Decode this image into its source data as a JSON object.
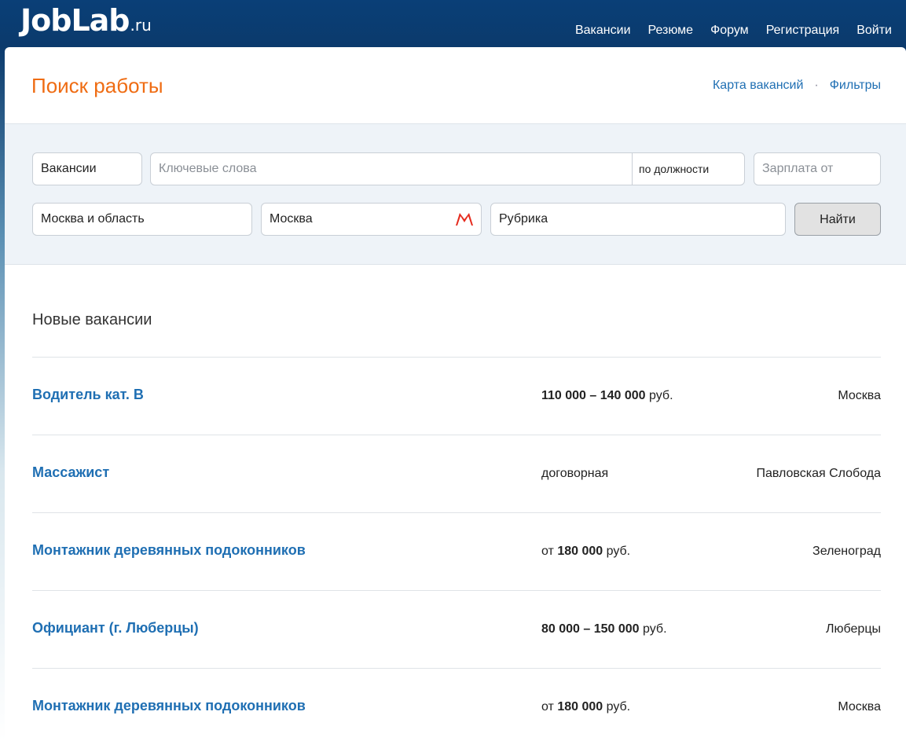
{
  "header": {
    "logo_main": "JobLab",
    "logo_tld": ".ru",
    "nav": [
      "Вакансии",
      "Резюме",
      "Форум",
      "Регистрация",
      "Войти"
    ]
  },
  "page": {
    "title": "Поиск работы",
    "links": [
      "Карта вакансий",
      "Фильтры"
    ],
    "link_separator": "·"
  },
  "search": {
    "type_value": "Вакансии",
    "keywords_placeholder": "Ключевые слова",
    "keywords_mode": "по должности",
    "salary_placeholder": "Зарплата от",
    "region_value": "Москва и область",
    "city_value": "Москва",
    "rubric_value": "Рубрика",
    "submit_label": "Найти",
    "metro_icon": "metro-icon",
    "metro_color": "#e52b1e"
  },
  "jobs_section": {
    "title": "Новые вакансии",
    "items": [
      {
        "title": "Водитель кат. В",
        "salary_prefix": "",
        "salary_amount": "110 000 – 140 000",
        "salary_unit": " руб.",
        "city": "Москва"
      },
      {
        "title": "Массажист",
        "salary_prefix": "договорная",
        "salary_amount": "",
        "salary_unit": "",
        "city": "Павловская Слобода"
      },
      {
        "title": "Монтажник деревянных подоконников",
        "salary_prefix": "от ",
        "salary_amount": "180 000",
        "salary_unit": " руб.",
        "city": "Зеленоград"
      },
      {
        "title": "Официант (г. Люберцы)",
        "salary_prefix": "",
        "salary_amount": "80 000 – 150 000",
        "salary_unit": " руб.",
        "city": "Люберцы"
      },
      {
        "title": "Монтажник деревянных подоконников",
        "salary_prefix": "от ",
        "salary_amount": "180 000",
        "salary_unit": " руб.",
        "city": "Москва"
      }
    ]
  },
  "colors": {
    "brand_blue": "#0b3a6c",
    "accent_orange": "#ef6c13",
    "link_blue": "#1f6fb3"
  }
}
